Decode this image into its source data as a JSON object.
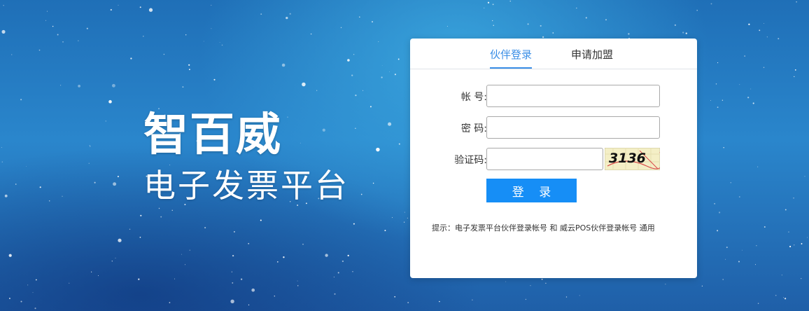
{
  "brand": {
    "title": "智百威",
    "subtitle": "电子发票平台"
  },
  "tabs": [
    {
      "label": "伙伴登录",
      "active": true
    },
    {
      "label": "申请加盟",
      "active": false
    }
  ],
  "form": {
    "account_label": "帐 号:",
    "password_label": "密 码:",
    "captcha_label": "验证码:",
    "account_value": "",
    "password_value": "",
    "captcha_value": "",
    "captcha_code": "3136",
    "login_label": "登 录"
  },
  "hint": "提示：电子发票平台伙伴登录帐号 和 威云POS伙伴登录帐号 通用",
  "colors": {
    "accent": "#3a8ee6",
    "button": "#168ef6",
    "background": "#2a86cc"
  }
}
